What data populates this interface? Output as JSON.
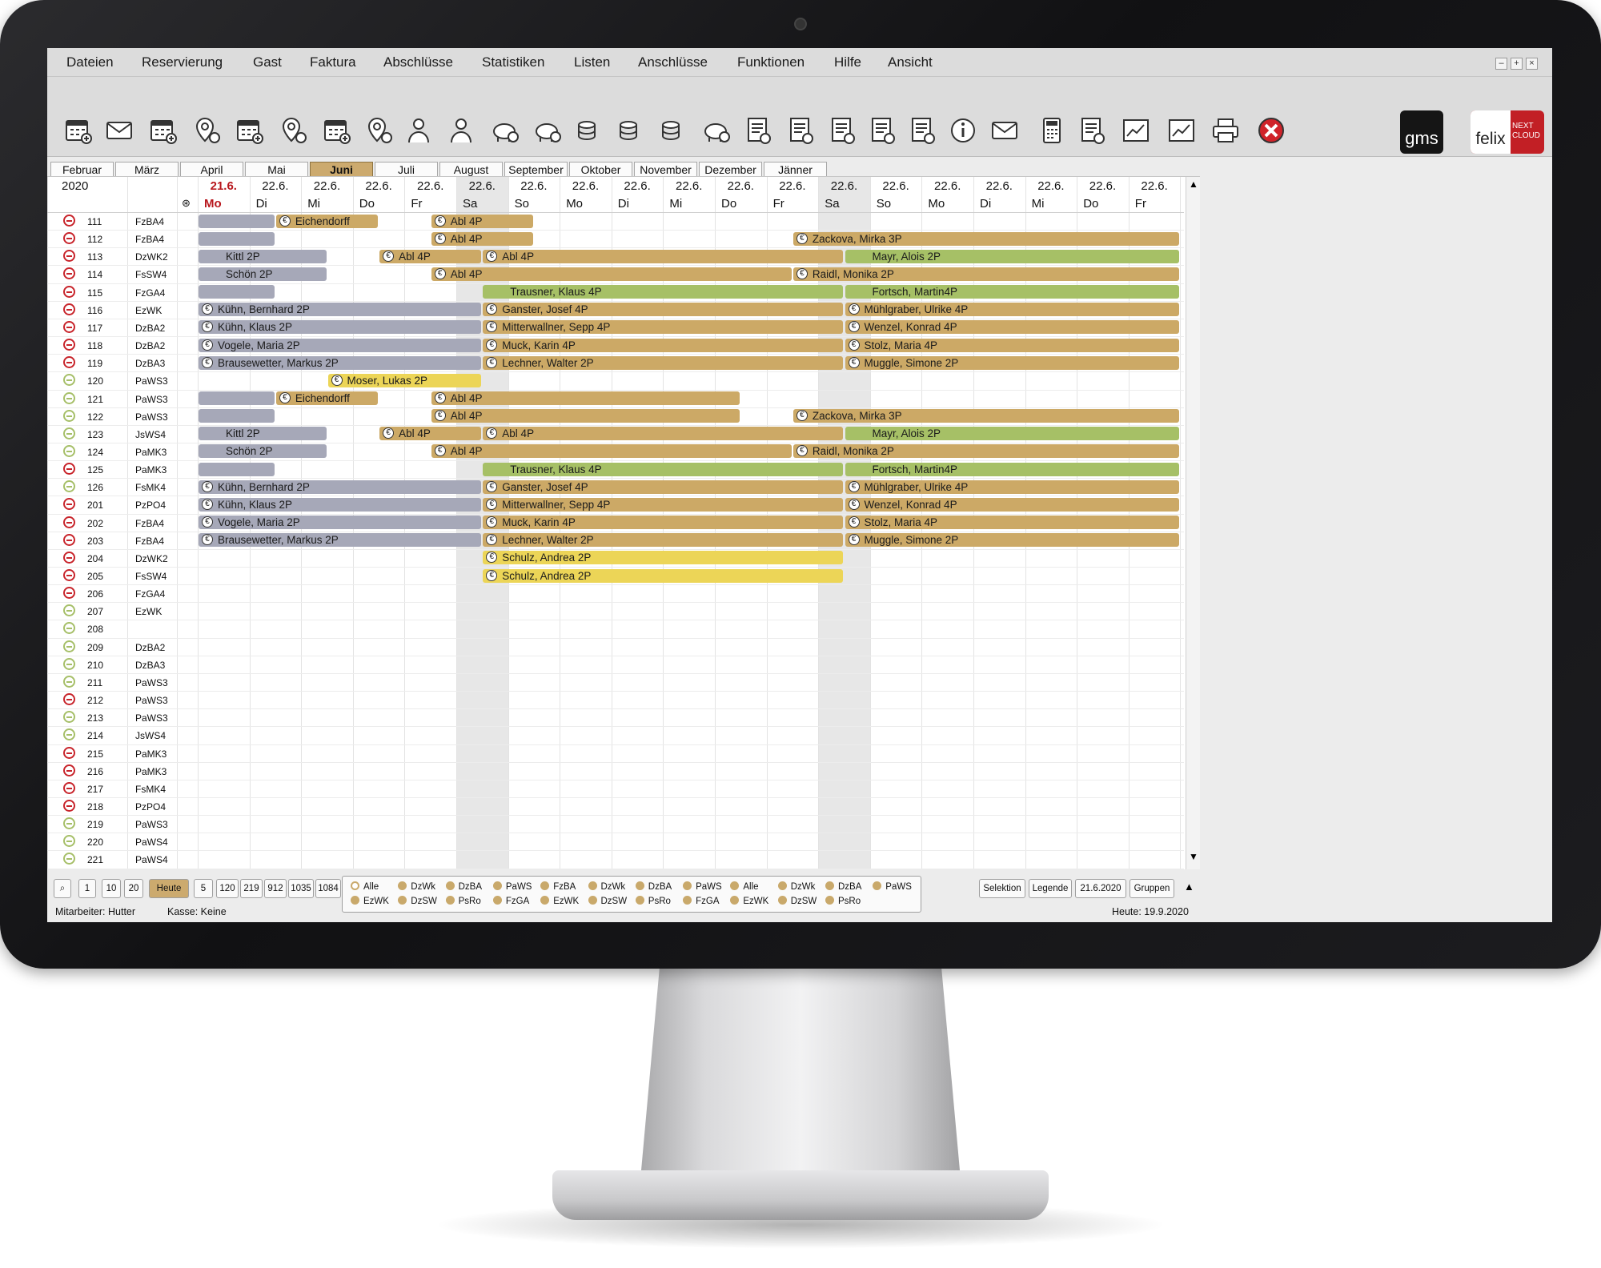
{
  "menu": [
    "Dateien",
    "Reservierung",
    "Gast",
    "Faktura",
    "Abschlüsse",
    "Statistiken",
    "Listen",
    "Anschlüsse",
    "Funktionen",
    "Hilfe",
    "Ansicht"
  ],
  "window_controls": [
    "–",
    "+",
    "×"
  ],
  "toolbar_icons": [
    "calendar-add-icon",
    "mail-add-icon",
    "calendar-person-icon",
    "location-add-icon",
    "calendar-add-icon",
    "locations-add-icon",
    "calendar-check-icon",
    "location-star-icon",
    "person-touch-icon",
    "persons-icon",
    "piggy-bank-add-icon",
    "piggy-bank-remove-icon",
    "coins-add-icon",
    "coins-icon",
    "coins-calendar-icon",
    "piggy-bank-search-icon",
    "invoice-add-icon",
    "receipt-icon",
    "invoice-add-icon",
    "invoice-star-icon",
    "invoice-remove-icon",
    "info-icon",
    "mail-icon",
    "calculator-icon",
    "documents-icon",
    "chart-icon",
    "chart-calendar-icon",
    "printer-icon",
    "close-red-icon"
  ],
  "logos": {
    "gms": "gms",
    "felix": "felix",
    "felix_sub": "NEXT CLOUD"
  },
  "months": [
    "Februar",
    "März",
    "April",
    "Mai",
    "Juni",
    "Juli",
    "August",
    "September",
    "Oktober",
    "November",
    "Dezember",
    "Jänner"
  ],
  "active_month": "Juni",
  "year": "2020",
  "days": [
    {
      "date": "21.6.",
      "wd": "Mo",
      "today": true
    },
    {
      "date": "22.6.",
      "wd": "Di"
    },
    {
      "date": "22.6.",
      "wd": "Mi"
    },
    {
      "date": "22.6.",
      "wd": "Do"
    },
    {
      "date": "22.6.",
      "wd": "Fr"
    },
    {
      "date": "22.6.",
      "wd": "Sa",
      "weekend": true
    },
    {
      "date": "22.6.",
      "wd": "So"
    },
    {
      "date": "22.6.",
      "wd": "Mo"
    },
    {
      "date": "22.6.",
      "wd": "Di"
    },
    {
      "date": "22.6.",
      "wd": "Mi"
    },
    {
      "date": "22.6.",
      "wd": "Do"
    },
    {
      "date": "22.6.",
      "wd": "Fr"
    },
    {
      "date": "22.6.",
      "wd": "Sa",
      "weekend": true
    },
    {
      "date": "22.6.",
      "wd": "So"
    },
    {
      "date": "22.6.",
      "wd": "Mo"
    },
    {
      "date": "22.6.",
      "wd": "Di"
    },
    {
      "date": "22.6.",
      "wd": "Mi"
    },
    {
      "date": "22.6.",
      "wd": "Do"
    },
    {
      "date": "22.6.",
      "wd": "Fr"
    }
  ],
  "rooms": [
    {
      "no": "111",
      "cat": "FzBA4",
      "s": "red"
    },
    {
      "no": "112",
      "cat": "FzBA4",
      "s": "red"
    },
    {
      "no": "113",
      "cat": "DzWK2",
      "s": "red"
    },
    {
      "no": "114",
      "cat": "FsSW4",
      "s": "red"
    },
    {
      "no": "115",
      "cat": "FzGA4",
      "s": "red"
    },
    {
      "no": "116",
      "cat": "EzWK",
      "s": "red"
    },
    {
      "no": "117",
      "cat": "DzBA2",
      "s": "red"
    },
    {
      "no": "118",
      "cat": "DzBA2",
      "s": "red"
    },
    {
      "no": "119",
      "cat": "DzBA3",
      "s": "red"
    },
    {
      "no": "120",
      "cat": "PaWS3",
      "s": "green"
    },
    {
      "no": "121",
      "cat": "PaWS3",
      "s": "green"
    },
    {
      "no": "122",
      "cat": "PaWS3",
      "s": "green"
    },
    {
      "no": "123",
      "cat": "JsWS4",
      "s": "green"
    },
    {
      "no": "124",
      "cat": "PaMK3",
      "s": "green"
    },
    {
      "no": "125",
      "cat": "PaMK3",
      "s": "red"
    },
    {
      "no": "126",
      "cat": "FsMK4",
      "s": "green"
    },
    {
      "no": "201",
      "cat": "PzPO4",
      "s": "red"
    },
    {
      "no": "202",
      "cat": "FzBA4",
      "s": "red"
    },
    {
      "no": "203",
      "cat": "FzBA4",
      "s": "red"
    },
    {
      "no": "204",
      "cat": "DzWK2",
      "s": "red"
    },
    {
      "no": "205",
      "cat": "FsSW4",
      "s": "red"
    },
    {
      "no": "206",
      "cat": "FzGA4",
      "s": "red"
    },
    {
      "no": "207",
      "cat": "EzWK",
      "s": "green"
    },
    {
      "no": "208",
      "cat": "",
      "s": "green"
    },
    {
      "no": "209",
      "cat": "DzBA2",
      "s": "green"
    },
    {
      "no": "210",
      "cat": "DzBA3",
      "s": "green"
    },
    {
      "no": "211",
      "cat": "PaWS3",
      "s": "green"
    },
    {
      "no": "212",
      "cat": "PaWS3",
      "s": "red"
    },
    {
      "no": "213",
      "cat": "PaWS3",
      "s": "green"
    },
    {
      "no": "214",
      "cat": "JsWS4",
      "s": "green"
    },
    {
      "no": "215",
      "cat": "PaMK3",
      "s": "red"
    },
    {
      "no": "216",
      "cat": "PaMK3",
      "s": "red"
    },
    {
      "no": "217",
      "cat": "FsMK4",
      "s": "red"
    },
    {
      "no": "218",
      "cat": "PzPO4",
      "s": "red"
    },
    {
      "no": "219",
      "cat": "PaWS3",
      "s": "green"
    },
    {
      "no": "220",
      "cat": "PaWS4",
      "s": "green"
    },
    {
      "no": "221",
      "cat": "PaWS4",
      "s": "green"
    }
  ],
  "bookings": [
    {
      "row": 0,
      "from": 0,
      "to": 1.5,
      "label": "",
      "color": "gray",
      "euro": false
    },
    {
      "row": 0,
      "from": 1.5,
      "to": 3.5,
      "label": "Eichendorff",
      "color": "tan",
      "euro": true
    },
    {
      "row": 0,
      "from": 4.5,
      "to": 6.5,
      "label": "Abl 4P",
      "color": "tan",
      "euro": true
    },
    {
      "row": 1,
      "from": 0,
      "to": 1.5,
      "label": "",
      "color": "gray",
      "euro": false
    },
    {
      "row": 1,
      "from": 4.5,
      "to": 6.5,
      "label": "Abl 4P",
      "color": "tan",
      "euro": true
    },
    {
      "row": 1,
      "from": 11.5,
      "to": 19,
      "label": "Zackova, Mirka 3P",
      "color": "tan",
      "euro": true
    },
    {
      "row": 2,
      "from": 0,
      "to": 2.5,
      "label": "Kittl 2P",
      "color": "gray",
      "euro": false
    },
    {
      "row": 2,
      "from": 3.5,
      "to": 5.5,
      "label": "Abl 4P",
      "color": "tan",
      "euro": true
    },
    {
      "row": 2,
      "from": 5.5,
      "to": 12.5,
      "label": "Abl 4P",
      "color": "tan",
      "euro": true
    },
    {
      "row": 2,
      "from": 12.5,
      "to": 19,
      "label": "Mayr, Alois 2P",
      "color": "green",
      "euro": false
    },
    {
      "row": 3,
      "from": 0,
      "to": 2.5,
      "label": "Schön 2P",
      "color": "gray",
      "euro": false
    },
    {
      "row": 3,
      "from": 4.5,
      "to": 11.5,
      "label": "Abl 4P",
      "color": "tan",
      "euro": true
    },
    {
      "row": 3,
      "from": 11.5,
      "to": 19,
      "label": "Raidl, Monika 2P",
      "color": "tan",
      "euro": true
    },
    {
      "row": 4,
      "from": 0,
      "to": 1.5,
      "label": "",
      "color": "gray",
      "euro": false
    },
    {
      "row": 4,
      "from": 5.5,
      "to": 12.5,
      "label": "Trausner, Klaus 4P",
      "color": "green",
      "euro": false
    },
    {
      "row": 4,
      "from": 12.5,
      "to": 19,
      "label": "Fortsch, Martin4P",
      "color": "green",
      "euro": false
    },
    {
      "row": 5,
      "from": 0,
      "to": 5.5,
      "label": "Kühn, Bernhard 2P",
      "color": "gray",
      "euro": true
    },
    {
      "row": 5,
      "from": 5.5,
      "to": 12.5,
      "label": "Ganster, Josef 4P",
      "color": "tan",
      "euro": true
    },
    {
      "row": 5,
      "from": 12.5,
      "to": 19,
      "label": "Mühlgraber, Ulrike 4P",
      "color": "tan",
      "euro": true
    },
    {
      "row": 6,
      "from": 0,
      "to": 5.5,
      "label": "Kühn, Klaus 2P",
      "color": "gray",
      "euro": true
    },
    {
      "row": 6,
      "from": 5.5,
      "to": 12.5,
      "label": "Mitterwallner, Sepp 4P",
      "color": "tan",
      "euro": true
    },
    {
      "row": 6,
      "from": 12.5,
      "to": 19,
      "label": "Wenzel, Konrad 4P",
      "color": "tan",
      "euro": true
    },
    {
      "row": 7,
      "from": 0,
      "to": 5.5,
      "label": "Vogele, Maria 2P",
      "color": "gray",
      "euro": true
    },
    {
      "row": 7,
      "from": 5.5,
      "to": 12.5,
      "label": "Muck, Karin 4P",
      "color": "tan",
      "euro": true
    },
    {
      "row": 7,
      "from": 12.5,
      "to": 19,
      "label": "Stolz, Maria 4P",
      "color": "tan",
      "euro": true
    },
    {
      "row": 8,
      "from": 0,
      "to": 5.5,
      "label": "Brausewetter, Markus 2P",
      "color": "gray",
      "euro": true
    },
    {
      "row": 8,
      "from": 5.5,
      "to": 12.5,
      "label": "Lechner, Walter 2P",
      "color": "tan",
      "euro": true
    },
    {
      "row": 8,
      "from": 12.5,
      "to": 19,
      "label": "Muggle, Simone 2P",
      "color": "tan",
      "euro": true
    },
    {
      "row": 9,
      "from": 2.5,
      "to": 5.5,
      "label": "Moser, Lukas 2P",
      "color": "yellow",
      "euro": true
    },
    {
      "row": 10,
      "from": 0,
      "to": 1.5,
      "label": "",
      "color": "gray",
      "euro": false
    },
    {
      "row": 10,
      "from": 1.5,
      "to": 3.5,
      "label": "Eichendorff",
      "color": "tan",
      "euro": true
    },
    {
      "row": 10,
      "from": 4.5,
      "to": 10.5,
      "label": "Abl 4P",
      "color": "tan",
      "euro": true
    },
    {
      "row": 11,
      "from": 0,
      "to": 1.5,
      "label": "",
      "color": "gray",
      "euro": false
    },
    {
      "row": 11,
      "from": 4.5,
      "to": 10.5,
      "label": "Abl 4P",
      "color": "tan",
      "euro": true
    },
    {
      "row": 11,
      "from": 11.5,
      "to": 19,
      "label": "Zackova, Mirka 3P",
      "color": "tan",
      "euro": true
    },
    {
      "row": 12,
      "from": 0,
      "to": 2.5,
      "label": "Kittl 2P",
      "color": "gray",
      "euro": false
    },
    {
      "row": 12,
      "from": 3.5,
      "to": 5.5,
      "label": "Abl 4P",
      "color": "tan",
      "euro": true
    },
    {
      "row": 12,
      "from": 5.5,
      "to": 12.5,
      "label": "Abl 4P",
      "color": "tan",
      "euro": true
    },
    {
      "row": 12,
      "from": 12.5,
      "to": 19,
      "label": "Mayr, Alois 2P",
      "color": "green",
      "euro": false
    },
    {
      "row": 13,
      "from": 0,
      "to": 2.5,
      "label": "Schön 2P",
      "color": "gray",
      "euro": false
    },
    {
      "row": 13,
      "from": 4.5,
      "to": 11.5,
      "label": "Abl 4P",
      "color": "tan",
      "euro": true
    },
    {
      "row": 13,
      "from": 11.5,
      "to": 19,
      "label": "Raidl, Monika 2P",
      "color": "tan",
      "euro": true
    },
    {
      "row": 14,
      "from": 0,
      "to": 1.5,
      "label": "",
      "color": "gray",
      "euro": false
    },
    {
      "row": 14,
      "from": 5.5,
      "to": 12.5,
      "label": "Trausner, Klaus 4P",
      "color": "green",
      "euro": false
    },
    {
      "row": 14,
      "from": 12.5,
      "to": 19,
      "label": "Fortsch, Martin4P",
      "color": "green",
      "euro": false
    },
    {
      "row": 15,
      "from": 0,
      "to": 5.5,
      "label": "Kühn, Bernhard 2P",
      "color": "gray",
      "euro": true
    },
    {
      "row": 15,
      "from": 5.5,
      "to": 12.5,
      "label": "Ganster, Josef 4P",
      "color": "tan",
      "euro": true
    },
    {
      "row": 15,
      "from": 12.5,
      "to": 19,
      "label": "Mühlgraber, Ulrike 4P",
      "color": "tan",
      "euro": true
    },
    {
      "row": 16,
      "from": 0,
      "to": 5.5,
      "label": "Kühn, Klaus 2P",
      "color": "gray",
      "euro": true
    },
    {
      "row": 16,
      "from": 5.5,
      "to": 12.5,
      "label": "Mitterwallner, Sepp 4P",
      "color": "tan",
      "euro": true
    },
    {
      "row": 16,
      "from": 12.5,
      "to": 19,
      "label": "Wenzel, Konrad 4P",
      "color": "tan",
      "euro": true
    },
    {
      "row": 17,
      "from": 0,
      "to": 5.5,
      "label": "Vogele, Maria 2P",
      "color": "gray",
      "euro": true
    },
    {
      "row": 17,
      "from": 5.5,
      "to": 12.5,
      "label": "Muck, Karin 4P",
      "color": "tan",
      "euro": true
    },
    {
      "row": 17,
      "from": 12.5,
      "to": 19,
      "label": "Stolz, Maria 4P",
      "color": "tan",
      "euro": true
    },
    {
      "row": 18,
      "from": 0,
      "to": 5.5,
      "label": "Brausewetter, Markus 2P",
      "color": "gray",
      "euro": true
    },
    {
      "row": 18,
      "from": 5.5,
      "to": 12.5,
      "label": "Lechner, Walter 2P",
      "color": "tan",
      "euro": true
    },
    {
      "row": 18,
      "from": 12.5,
      "to": 19,
      "label": "Muggle, Simone 2P",
      "color": "tan",
      "euro": true
    },
    {
      "row": 19,
      "from": 5.5,
      "to": 12.5,
      "label": "Schulz, Andrea 2P",
      "color": "yellow",
      "euro": true
    },
    {
      "row": 20,
      "from": 5.5,
      "to": 12.5,
      "label": "Schulz, Andrea 2P",
      "color": "yellow",
      "euro": true
    }
  ],
  "bottom": {
    "zoom_buttons": [
      "1",
      "10",
      "20"
    ],
    "today_button": "Heute",
    "range_buttons": [
      "5",
      "120",
      "219",
      "912",
      "1035",
      "1084"
    ],
    "filters_row1": [
      "Alle",
      "DzWk",
      "DzBA",
      "PaWS",
      "FzBA",
      "DzWk",
      "DzBA",
      "PaWS",
      "Alle",
      "DzWk",
      "DzBA",
      "PaWS"
    ],
    "filters_row2": [
      "EzWK",
      "DzSW",
      "PsRo",
      "FzGA",
      "EzWK",
      "DzSW",
      "PsRo",
      "FzGA",
      "EzWK",
      "DzSW",
      "PsRo"
    ],
    "right_buttons": [
      "Selektion",
      "Legende",
      "21.6.2020",
      "Gruppen"
    ],
    "employee": "Mitarbeiter: Hutter",
    "cashbox": "Kasse: Keine",
    "today_label": "Heute: 19.9.2020"
  },
  "colors": {
    "gray": "#a6a8b8",
    "tan": "#cca966",
    "green": "#a6c066",
    "yellow": "#ecd557",
    "today": "#b8181e"
  }
}
